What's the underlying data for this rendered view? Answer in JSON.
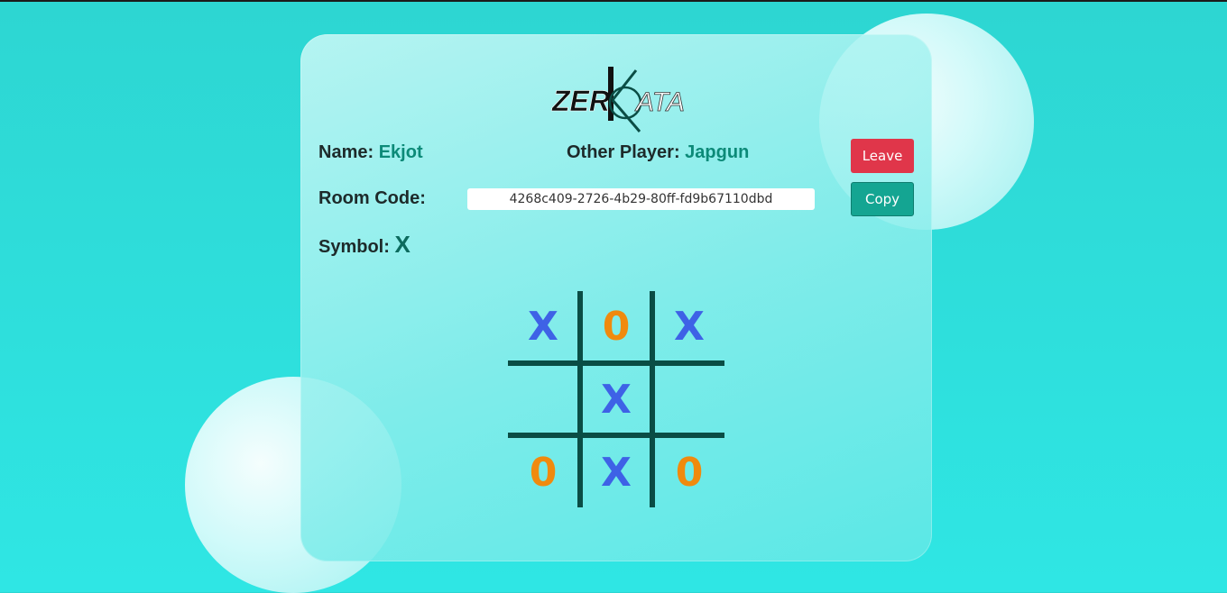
{
  "logo": {
    "text": "ZERKATA",
    "left": "ZER",
    "k": "K",
    "right": "ATA"
  },
  "player": {
    "label": "Name:",
    "name": "Ekjot"
  },
  "opponent": {
    "label": "Other Player:",
    "name": "Japgun"
  },
  "room": {
    "label": "Room Code:",
    "code": "4268c409-2726-4b29-80ff-fd9b67110dbd"
  },
  "symbol": {
    "label": "Symbol:",
    "value": "X"
  },
  "buttons": {
    "leave": "Leave",
    "copy": "Copy"
  },
  "board": {
    "cells": [
      "X",
      "0",
      "X",
      "",
      "X",
      "",
      "0",
      "X",
      "0"
    ]
  },
  "colors": {
    "background": "#2dd6d2",
    "accent": "#0c8a78",
    "leave": "#e0364a",
    "copy": "#14a592",
    "x_mark": "#3e62e6",
    "o_mark": "#f08a0e",
    "grid": "#0a4d45"
  }
}
